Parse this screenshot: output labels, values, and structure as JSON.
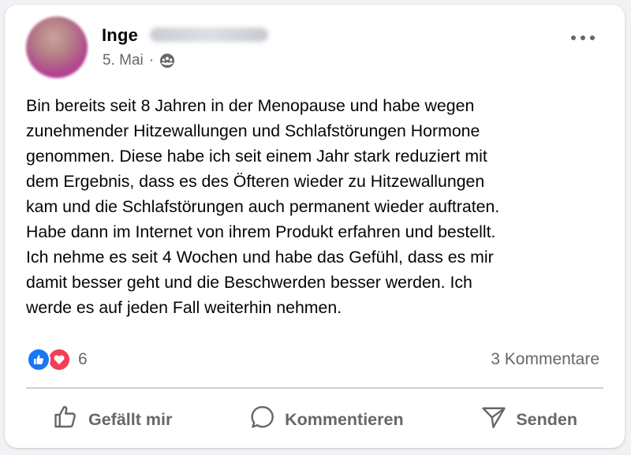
{
  "post": {
    "author_first_name": "Inge",
    "date": "5. Mai",
    "separator": "·",
    "audience_icon": "group-icon",
    "text": "Bin bereits seit 8 Jahren in der Menopause und habe wegen\nzunehmender Hitzewallungen und Schlafstörungen Hormone\ngenommen. Diese habe ich seit einem Jahr stark reduziert mit\ndem Ergebnis, dass es des Öfteren wieder zu Hitzewallungen\nkam und die Schlafstörungen auch permanent wieder auftraten.\nHabe dann im Internet von ihrem Produkt erfahren und bestellt.\nIch nehme es seit 4 Wochen und habe das Gefühl, dass es mir\ndamit besser geht und die Beschwerden besser werden. Ich\nwerde es auf jeden Fall weiterhin nehmen."
  },
  "reactions": {
    "icons": [
      "like-icon",
      "love-icon"
    ],
    "count": "6"
  },
  "comments": {
    "count_label": "3 Kommentare"
  },
  "actions": {
    "like_label": "Gefällt mir",
    "comment_label": "Kommentieren",
    "share_label": "Senden"
  },
  "colors": {
    "like_blue": "#1877f2",
    "love_red": "#f33e58",
    "secondary_text": "#65676b",
    "primary_text": "#050505"
  }
}
